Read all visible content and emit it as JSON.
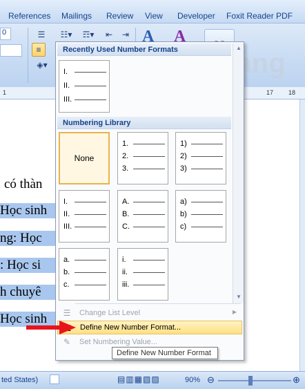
{
  "ribbon": {
    "tabs": [
      "References",
      "Mailings",
      "Review",
      "View",
      "Developer",
      "Foxit Reader PDF"
    ],
    "style_letter": "A"
  },
  "ruler": {
    "labels": [
      "1",
      "17",
      "18"
    ]
  },
  "document": {
    "lines": [
      {
        "text": "có thàn",
        "selected": false
      },
      {
        "text": "Học sinh",
        "selected": true
      },
      {
        "text": "ng: Học",
        "selected": true
      },
      {
        "text": ": Học si",
        "selected": true
      },
      {
        "text": "h chuyê",
        "selected": true
      },
      {
        "text": "Học sinh",
        "selected": true
      }
    ]
  },
  "status": {
    "language": "ted States)",
    "zoom": "90%"
  },
  "panel": {
    "recent_header": "Recently Used Number Formats",
    "library_header": "Numbering Library",
    "recent_tile": [
      "I.",
      "II.",
      "III."
    ],
    "library_tiles": [
      {
        "none": "None"
      },
      {
        "rows": [
          "1.",
          "2.",
          "3."
        ]
      },
      {
        "rows": [
          "1)",
          "2)",
          "3)"
        ]
      },
      {
        "rows": [
          "I.",
          "II.",
          "III."
        ]
      },
      {
        "rows": [
          "A.",
          "B.",
          "C."
        ]
      },
      {
        "rows": [
          "a)",
          "b)",
          "c)"
        ]
      },
      {
        "rows": [
          "a.",
          "b.",
          "c."
        ]
      },
      {
        "rows": [
          "i.",
          "ii.",
          "iii."
        ]
      }
    ],
    "menu": {
      "change_level": "Change List Level",
      "define_new": "Define New Number Format...",
      "set_value": "Set Numbering Value..."
    }
  },
  "tooltip": "Define New Number Format",
  "watermark": "uantrimang",
  "colors": {
    "highlight": "#ffe184",
    "selection": "#a9c7ee",
    "arrow": "#e8141c"
  }
}
